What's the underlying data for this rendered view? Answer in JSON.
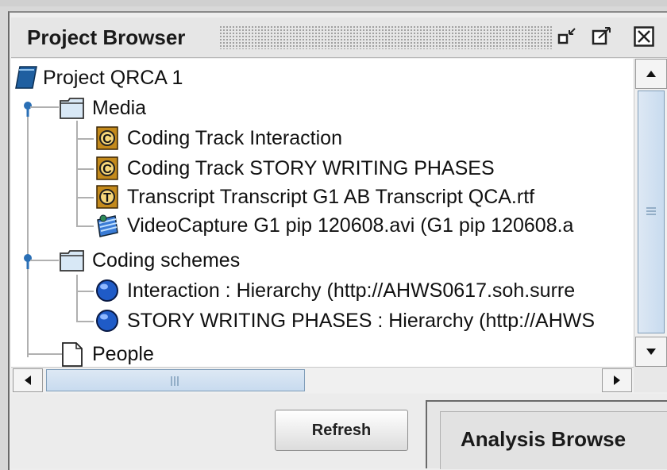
{
  "panel": {
    "title": "Project Browser",
    "controls": [
      "minimize-icon",
      "maximize-icon",
      "close-icon"
    ]
  },
  "tree": {
    "root": {
      "label": "Project QRCA 1",
      "icon": "project-book-icon"
    },
    "groups": [
      {
        "label": "Media",
        "icon": "folder-icon",
        "children": [
          {
            "label": "Coding Track Interaction",
            "icon": "coding-track-icon"
          },
          {
            "label": "Coding Track STORY WRITING PHASES",
            "icon": "coding-track-icon"
          },
          {
            "label": "Transcript Transcript G1 AB Transcript QCA.rtf",
            "icon": "transcript-icon"
          },
          {
            "label": "VideoCapture G1 pip 120608.avi (G1 pip 120608.a",
            "icon": "video-icon"
          }
        ]
      },
      {
        "label": "Coding schemes",
        "icon": "folder-icon",
        "children": [
          {
            "label": "Interaction : Hierarchy (http://AHWS0617.soh.surre",
            "icon": "scheme-globe-icon"
          },
          {
            "label": "STORY WRITING PHASES : Hierarchy (http://AHWS",
            "icon": "scheme-globe-icon"
          }
        ]
      },
      {
        "label": "People",
        "icon": "document-icon"
      }
    ]
  },
  "buttons": {
    "refresh": "Refresh"
  },
  "analysis_panel": {
    "title": "Analysis Browse"
  },
  "colors": {
    "folder": "#d8e8f6",
    "coding_track": "#c48a1c",
    "globe": "#1f5bc7",
    "project": "#1f5fa0"
  }
}
